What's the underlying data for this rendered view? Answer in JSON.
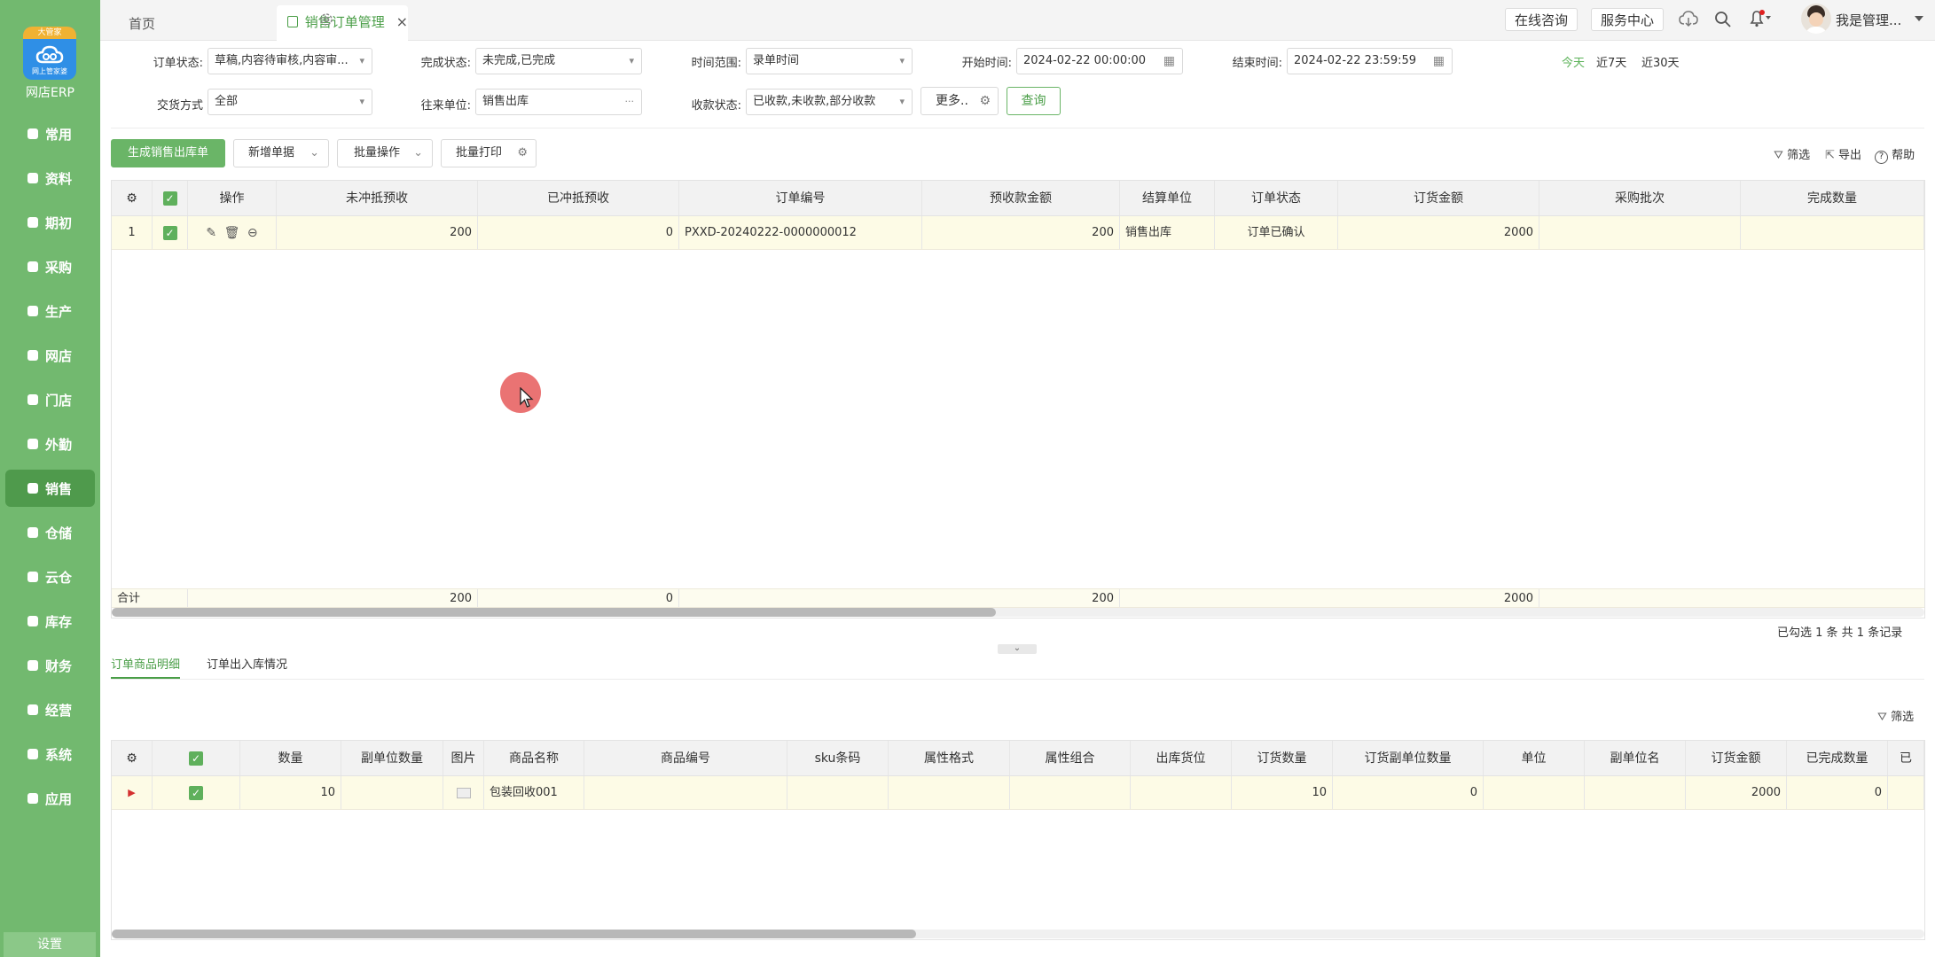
{
  "sidebar": {
    "brand": "网店ERP",
    "logo_badge": "大管家",
    "logo_label": "网上管家婆",
    "items": [
      {
        "label": "常用",
        "icon": "star-icon"
      },
      {
        "label": "资料",
        "icon": "document-icon"
      },
      {
        "label": "期初",
        "icon": "clock-icon"
      },
      {
        "label": "采购",
        "icon": "cart-icon"
      },
      {
        "label": "生产",
        "icon": "factory-icon"
      },
      {
        "label": "网店",
        "icon": "shop-icon"
      },
      {
        "label": "门店",
        "icon": "pie-icon"
      },
      {
        "label": "外勤",
        "icon": "target-icon"
      },
      {
        "label": "销售",
        "icon": "bar-chart-icon"
      },
      {
        "label": "仓储",
        "icon": "warehouse-icon"
      },
      {
        "label": "云仓",
        "icon": "cloud-warehouse-icon"
      },
      {
        "label": "库存",
        "icon": "stock-icon"
      },
      {
        "label": "财务",
        "icon": "finance-icon"
      },
      {
        "label": "经营",
        "icon": "business-icon"
      },
      {
        "label": "系统",
        "icon": "gear-icon"
      },
      {
        "label": "应用",
        "icon": "plus-icon"
      }
    ],
    "active_index": 8,
    "settings_label": "设置"
  },
  "tabs": {
    "home": "首页",
    "active": "销售订单管理",
    "close": "×"
  },
  "header": {
    "online_consult": "在线咨询",
    "service_center": "服务中心",
    "user_name": "我是管理..."
  },
  "filters": {
    "order_status_label": "订单状态:",
    "order_status_value": "草稿,内容待审核,内容审...",
    "complete_status_label": "完成状态:",
    "complete_status_value": "未完成,已完成",
    "time_range_label": "时间范围:",
    "time_range_value": "录单时间",
    "start_time_label": "开始时间:",
    "start_time_value": "2024-02-22 00:00:00",
    "end_time_label": "结束时间:",
    "end_time_value": "2024-02-22 23:59:59",
    "quick_today": "今天",
    "quick_7days": "近7天",
    "quick_30days": "近30天",
    "delivery_label": "交货方式",
    "delivery_value": "全部",
    "partner_label": "往来单位:",
    "partner_value": "销售出库",
    "partner_more": "···",
    "payment_label": "收款状态:",
    "payment_value": "已收款,未收款,部分收款",
    "more_button": "更多..",
    "query_button": "查询"
  },
  "toolbar": {
    "generate_button": "生成销售出库单",
    "new_doc_button": "新增单据",
    "batch_op_button": "批量操作",
    "batch_print_button": "批量打印",
    "filter_label": "筛选",
    "export_label": "导出",
    "help_label": "帮助"
  },
  "order_table": {
    "columns": [
      "操作",
      "未冲抵预收",
      "已冲抵预收",
      "订单编号",
      "预收款金额",
      "结算单位",
      "订单状态",
      "订货金额",
      "采购批次",
      "完成数量"
    ],
    "rows": [
      {
        "index": "1",
        "unoffset": "200",
        "offset": "0",
        "order_no": "PXXD-20240222-0000000012",
        "prepaid": "200",
        "settle_unit": "销售出库",
        "status": "订单已确认",
        "amount": "2000",
        "batch": "",
        "done_qty": ""
      }
    ],
    "totals": {
      "label": "合计",
      "unoffset": "200",
      "offset": "0",
      "prepaid": "200",
      "amount": "2000"
    },
    "summary": "已勾选 1 条  共 1 条记录"
  },
  "detail_tabs": {
    "items": "订单商品明细",
    "stock": "订单出入库情况",
    "filter_label": "筛选"
  },
  "detail_table": {
    "columns": [
      "数量",
      "副单位数量",
      "图片",
      "商品名称",
      "商品编号",
      "sku条码",
      "属性格式",
      "属性组合",
      "出库货位",
      "订货数量",
      "订货副单位数量",
      "单位",
      "副单位名",
      "订货金额",
      "已完成数量",
      "已"
    ],
    "rows": [
      {
        "qty": "10",
        "sub_qty": "",
        "product_name": "包装回收001",
        "order_qty": "10",
        "order_sub_qty": "0",
        "amount": "2000",
        "done_qty": "0"
      }
    ]
  }
}
